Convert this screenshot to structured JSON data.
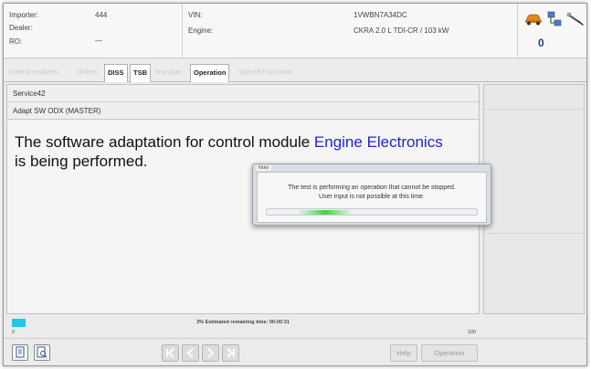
{
  "header": {
    "importer_label": "Importer:",
    "importer_value": "444",
    "dealer_label": "Dealer:",
    "dealer_value": "",
    "ro_label": "RO:",
    "ro_value": "—",
    "vin_label": "VIN:",
    "vin_value": "1VWBN7A34DC",
    "engine_label": "Engine:",
    "engine_value": "CKRA 2.0 L TDI-CR / 103 kW",
    "count": "0",
    "icons": [
      "car-icon",
      "network-icon",
      "probe-icon"
    ]
  },
  "tabs": [
    {
      "label": "Control modules",
      "active": false
    },
    {
      "label": "Orders",
      "active": false
    },
    {
      "label": "DISS",
      "active": true
    },
    {
      "label": "TSB",
      "active": true
    },
    {
      "label": "Test plan",
      "active": false
    },
    {
      "label": "Operation",
      "active": true
    },
    {
      "label": "Special Functions",
      "active": false
    }
  ],
  "content": {
    "line1": "Service42",
    "line2": "Adapt SW ODX (MASTER)",
    "message_pre": "The software adaptation for control module ",
    "message_highlight": "Engine Electronics",
    "message_post": " is being performed.",
    "highlight_color": "#2424c8"
  },
  "progress": {
    "percent": 3,
    "text": "3% Estimated remaining time: 00:00:31",
    "min": "0",
    "max": "100",
    "color": "#20c8e8"
  },
  "dialog": {
    "title": "Note",
    "line1": "The test is performing an operation that cannot be stopped.",
    "line2": "User input is not possible at this time."
  },
  "bottom": {
    "help_label": "Help",
    "operation_label": "Operation"
  }
}
